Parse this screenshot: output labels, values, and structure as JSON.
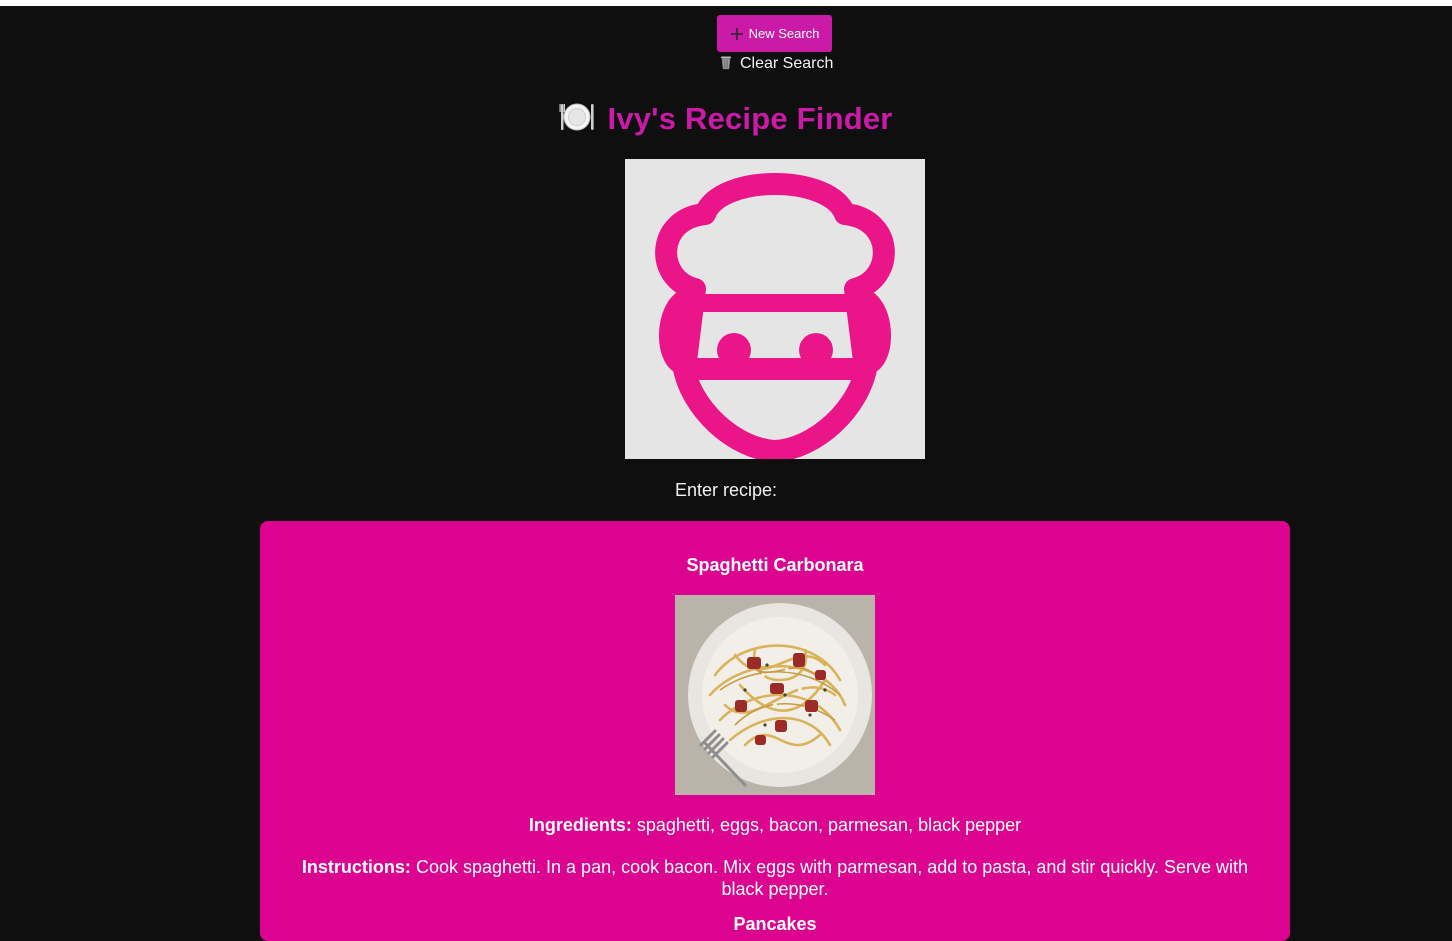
{
  "toolbar": {
    "new_search_label": "New Search",
    "new_search_icon": "plus-icon",
    "clear_search_label": "Clear Search",
    "clear_search_icon": "trash-icon"
  },
  "header": {
    "title": "Ivy's Recipe Finder",
    "title_icon": "plate-cutlery-icon",
    "logo_icon": "chef-icon"
  },
  "search": {
    "label": "Enter recipe:"
  },
  "recipes": [
    {
      "title": "Spaghetti Carbonara",
      "image_icon": "spaghetti-photo",
      "ingredients_label": "Ingredients:",
      "ingredients": "spaghetti, eggs, bacon, parmesan, black pepper",
      "instructions_label": "Instructions:",
      "instructions": "Cook spaghetti. In a pan, cook bacon. Mix eggs with parmesan, add to pasta, and stir quickly. Serve with black pepper."
    },
    {
      "title": "Pancakes"
    }
  ],
  "colors": {
    "background": "#0f0f10",
    "accent": "#cc1aa8",
    "card": "#dc0391",
    "logo_bg": "#e5e5e5",
    "logo_pink": "#ea1689"
  }
}
